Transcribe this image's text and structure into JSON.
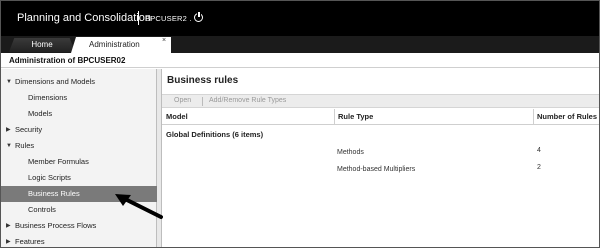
{
  "header": {
    "app_title": "Planning and Consolidation",
    "user": "BPCUSER2 .",
    "power_icon": "power-icon"
  },
  "tabs": {
    "home": "Home",
    "administration": "Administration",
    "close_glyph": "×"
  },
  "page": {
    "title": "Administration of BPCUSER02"
  },
  "sidebar": {
    "items": [
      {
        "label": "Dimensions and Models",
        "level": 0,
        "arrow": "▼"
      },
      {
        "label": "Dimensions",
        "level": 1,
        "arrow": ""
      },
      {
        "label": "Models",
        "level": 1,
        "arrow": ""
      },
      {
        "label": "Security",
        "level": 0,
        "arrow": "▶"
      },
      {
        "label": "Rules",
        "level": 0,
        "arrow": "▼"
      },
      {
        "label": "Member Formulas",
        "level": 1,
        "arrow": ""
      },
      {
        "label": "Logic Scripts",
        "level": 1,
        "arrow": ""
      },
      {
        "label": "Business Rules",
        "level": 1,
        "arrow": "",
        "selected": true
      },
      {
        "label": "Controls",
        "level": 1,
        "arrow": ""
      },
      {
        "label": "Business Process Flows",
        "level": 0,
        "arrow": "▶"
      },
      {
        "label": "Features",
        "level": 0,
        "arrow": "▶"
      }
    ]
  },
  "main": {
    "title": "Business rules",
    "toolbar": {
      "open": "Open",
      "add_remove": "Add/Remove Rule Types"
    },
    "columns": {
      "model": "Model",
      "rule_type": "Rule Type",
      "number_of_rules": "Number of Rules"
    },
    "group_label": "Global Definitions (6 items)",
    "rows": [
      {
        "rule_type": "Methods",
        "count": "4"
      },
      {
        "rule_type": "Method-based Multipliers",
        "count": "2"
      }
    ]
  },
  "colors": {
    "header_bg": "#000000",
    "selected_bg": "#7a7a7a",
    "nav_bg": "#f3f3f3"
  }
}
